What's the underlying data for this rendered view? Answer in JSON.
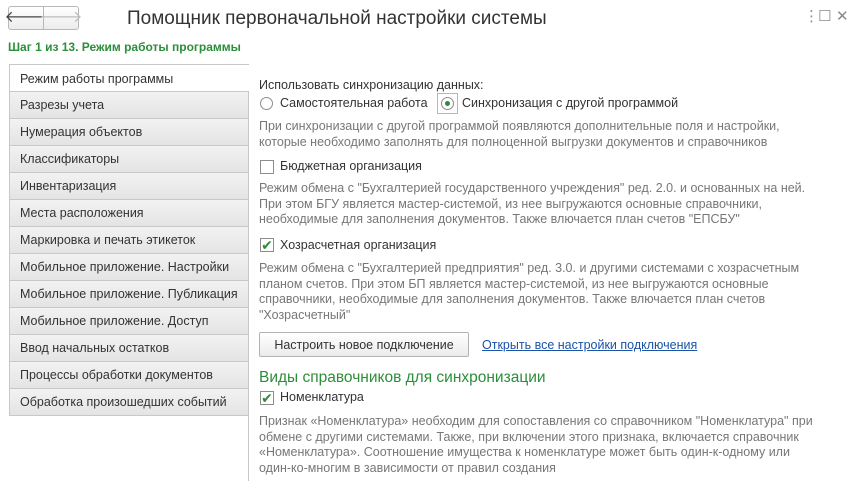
{
  "header": {
    "title": "Помощник первоначальной настройки системы",
    "back_glyph": "🡐",
    "forward_glyph": "🡒",
    "menu_glyph": "⋮",
    "maximize_glyph": "☐",
    "close_glyph": "✕",
    "step": "Шаг 1 из 13. Режим работы программы"
  },
  "sidebar": {
    "items": [
      {
        "label": "Режим работы программы",
        "active": true
      },
      {
        "label": "Разрезы учета"
      },
      {
        "label": "Нумерация объектов"
      },
      {
        "label": "Классификаторы"
      },
      {
        "label": "Инвентаризация"
      },
      {
        "label": "Места расположения"
      },
      {
        "label": "Маркировка и печать этикеток"
      },
      {
        "label": "Мобильное приложение. Настройки"
      },
      {
        "label": "Мобильное приложение. Публикация"
      },
      {
        "label": "Мобильное приложение. Доступ"
      },
      {
        "label": "Ввод начальных остатков"
      },
      {
        "label": "Процессы обработки документов"
      },
      {
        "label": "Обработка произошедших событий"
      }
    ]
  },
  "sync": {
    "caption": "Использовать синхронизацию данных:",
    "option_standalone": "Самостоятельная работа",
    "option_sync": "Синхронизация с другой программой",
    "selected": "Синхронизация с другой программой",
    "hint_line1": "При синхронизации с другой программой появляются дополнительные поля и настройки,",
    "hint_line2": "которые необходимо заполнять для полноценной выгрузки документов и справочников"
  },
  "budget": {
    "label": "Бюджетная организация",
    "checked": false,
    "hint_line1": "Режим обмена с \"Бухгалтерией государственного учреждения\" ред. 2.0. и основанных на ней.",
    "hint_line2": "При этом БГУ является мастер-системой, из нее выгружаются основные справочники,",
    "hint_line3": "необходимые для заполнения документов. Также влючается план счетов \"ЕПСБУ\""
  },
  "selfsupporting": {
    "label": "Хозрасчетная организация",
    "checked": true,
    "check_glyph": "✔",
    "hint_line1": "Режим обмена с \"Бухгалтерией предприятия\" ред. 3.0. и другими системами с хозрасчетным",
    "hint_line2": "планом счетов. При этом БП является мастер-системой, из нее выгружаются основные",
    "hint_line3": "справочники, необходимые для заполнения документов. Также влючается план счетов",
    "hint_line4": "\"Хозрасчетный\""
  },
  "actions": {
    "new_connection_button": "Настроить новое подключение",
    "open_settings_link": "Открыть все настройки подключения"
  },
  "catalogs": {
    "section_title": "Виды справочников для синхронизации",
    "nomenclature_label": "Номенклатура",
    "nomenclature_checked": true,
    "hint_line1": "Признак «Номенклатура» необходим для сопоставления со справочником \"Номенклатура\" при",
    "hint_line2": "обмене с другими системами. Также, при включении этого признака, включается справочник",
    "hint_line3": "«Номенклатура». Соотношение имущества к номенклатуре может быть один-к-одному или",
    "hint_line4": "один-ко-многим в зависимости от правил создания"
  },
  "colors": {
    "accent_green": "#2c8d3a",
    "link_blue": "#1a53a8",
    "hint_gray": "#777777",
    "focus_yellow": "#e0b64a"
  }
}
